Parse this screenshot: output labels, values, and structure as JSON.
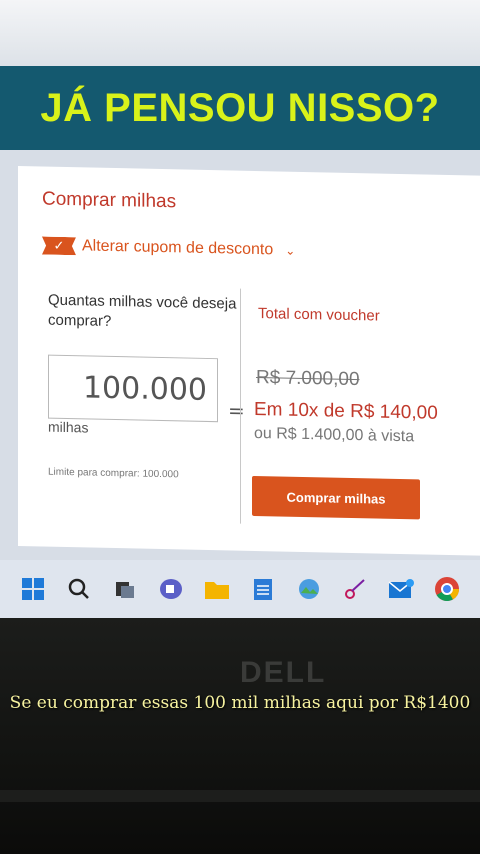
{
  "banner": {
    "title": "JÁ PENSOU NISSO?"
  },
  "card": {
    "title": "Comprar milhas",
    "coupon_label": "Alterar cupom de desconto",
    "quantity_question": "Quantas milhas você deseja comprar?",
    "quantity_value": "100.000",
    "unit": "milhas",
    "limit": "Limite para comprar: 100.000",
    "equals": "=",
    "total_label": "Total com voucher",
    "old_price": "R$ 7.000,00",
    "installments": "Em 10x de R$ 140,00",
    "cash_price": "ou R$ 1.400,00 à vista",
    "buy_button": "Comprar milhas"
  },
  "taskbar": {
    "icons": [
      "windows-start-icon",
      "search-icon",
      "task-view-icon",
      "teams-chat-icon",
      "file-explorer-icon",
      "notepad-icon",
      "photos-icon",
      "snipping-tool-icon",
      "mail-icon",
      "chrome-icon"
    ]
  },
  "brand": "DELL",
  "caption": "Se eu comprar essas 100 mil milhas aqui por R$1400"
}
